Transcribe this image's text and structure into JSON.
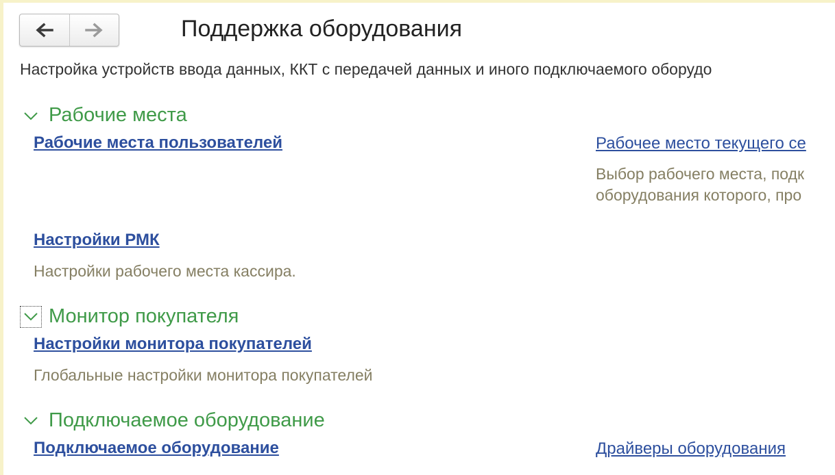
{
  "header": {
    "back_icon": "arrow-left-icon",
    "forward_icon": "arrow-right-icon",
    "title": "Поддержка оборудования",
    "subtitle": "Настройка устройств ввода данных, ККТ с передачей данных и иного подключаемого оборудо"
  },
  "sections": [
    {
      "title": "Рабочие места",
      "items": [
        {
          "label": "Рабочие места пользователей",
          "description": ""
        },
        {
          "label": "Рабочее место текущего се",
          "description_lines": [
            "Выбор рабочего места, подк",
            "оборудования которого, про"
          ]
        },
        {
          "label": "Настройки РМК",
          "description": "Настройки рабочего места кассира."
        }
      ]
    },
    {
      "title": "Монитор покупателя",
      "items": [
        {
          "label": "Настройки монитора покупателей",
          "description": "Глобальные настройки монитора покупателей"
        }
      ]
    },
    {
      "title": "Подключаемое оборудование",
      "items": [
        {
          "label": "Подключаемое оборудование",
          "description": ""
        },
        {
          "label": "Драйверы оборудования",
          "description": ""
        }
      ]
    }
  ],
  "colors": {
    "section_title": "#3f9a48",
    "link": "#2d4f9e",
    "description": "#857f63",
    "frame": "#f7f2c9"
  }
}
